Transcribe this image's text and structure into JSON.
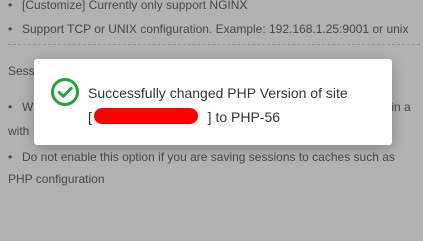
{
  "background": {
    "lines": [
      "[Customize] Currently only support NGINX",
      "Support TCP or UNIX configuration. Example: 192.168.1.25:9001 or unix",
      "Sessi",
      "Wh",
      "ot in a",
      "with",
      "Do not enable this option if you are saving sessions to caches such as",
      "PHP configuration"
    ]
  },
  "modal": {
    "message_line1": "Successfully changed PHP Version of site",
    "message_line2_open": "[",
    "message_line2_close": "]",
    "message_line2_suffix": " to PHP-56",
    "icon": "check-circle-icon",
    "accent_color": "#20a53a"
  }
}
